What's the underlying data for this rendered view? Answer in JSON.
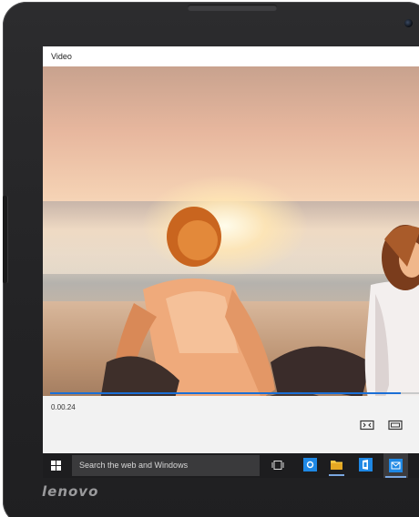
{
  "device": {
    "brand": "lenovo"
  },
  "window": {
    "title": "Video"
  },
  "player": {
    "timecode": "0.00.24",
    "progress_percent": 0.95
  },
  "taskbar": {
    "search_placeholder": "Search the web and Windows",
    "icons": [
      "task-view-icon",
      "settings-icon",
      "file-explorer-icon",
      "office-icon",
      "outlook-icon"
    ]
  },
  "colors": {
    "accent": "#1b6fd6",
    "taskbar": "#1d1d1f"
  }
}
